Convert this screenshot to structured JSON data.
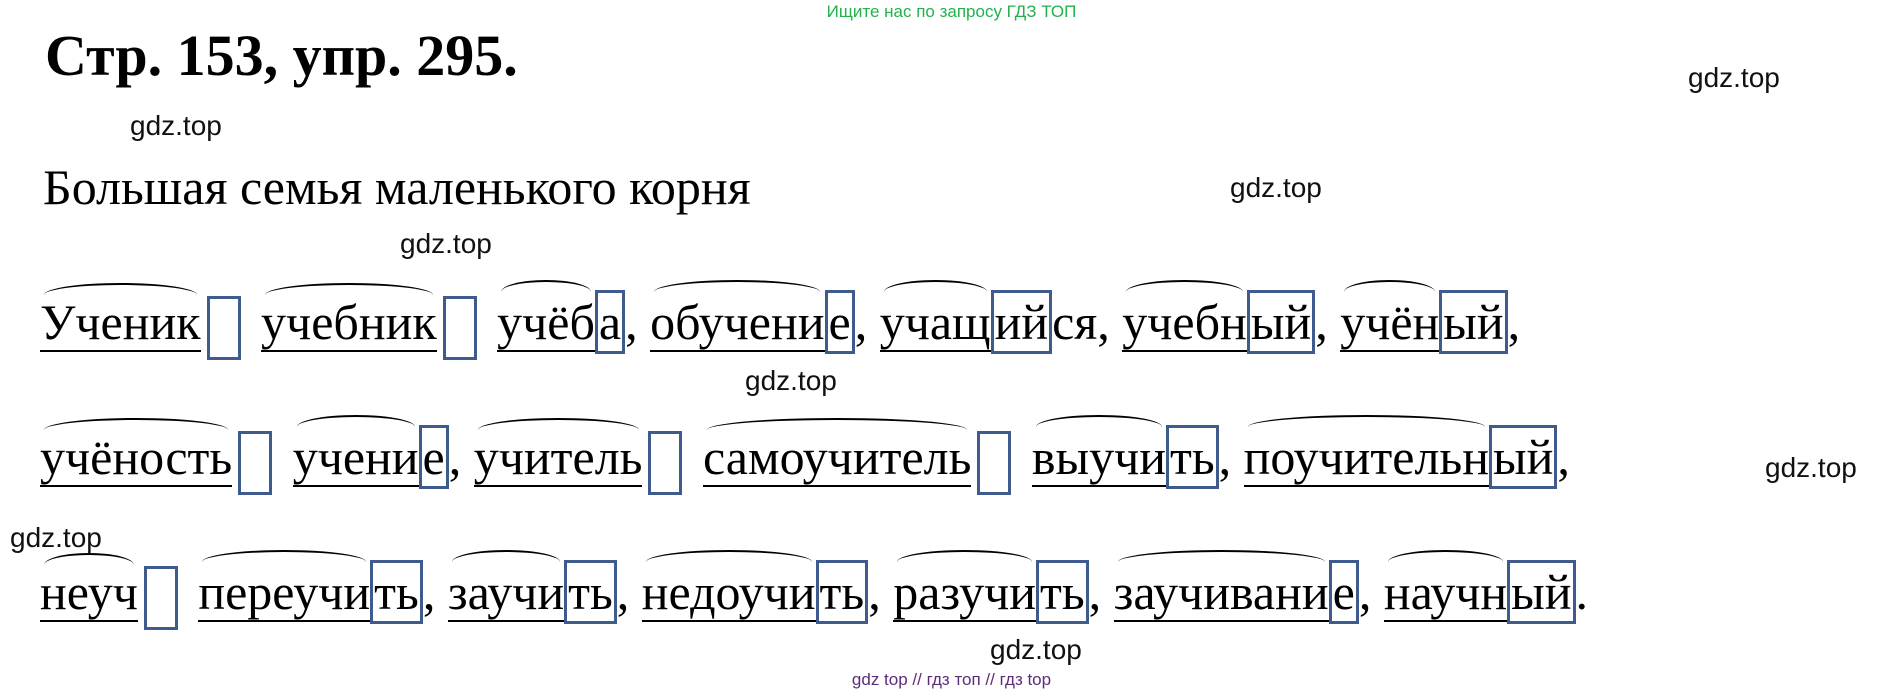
{
  "top_note": "Ищите нас по запросу ГДЗ ТОП",
  "heading": "Стр. 153, упр. 295.",
  "subtitle": "Большая семья маленького корня",
  "watermark": "gdz.top",
  "bottom_note": "gdz top  //  гдз топ  //  гдз top",
  "lines": [
    {
      "words": [
        {
          "text": "Ученик",
          "ending": "",
          "empty_ending": true,
          "punct": ""
        },
        {
          "text": "учебник",
          "ending": "",
          "empty_ending": true,
          "punct": ""
        },
        {
          "text": "учёб",
          "ending": "а",
          "punct": ","
        },
        {
          "text": "обучени",
          "ending": "е",
          "punct": ","
        },
        {
          "text": "уча щ",
          "ending": "ий",
          "suffix": "ся",
          "punct": ","
        },
        {
          "text": "учеб н",
          "ending": "ый",
          "punct": ","
        },
        {
          "text": "учён",
          "ending": "ый",
          "punct": ","
        }
      ]
    },
    {
      "words": [
        {
          "text": "учёность",
          "ending": "",
          "empty_ending": true,
          "punct": ""
        },
        {
          "text": "учени",
          "ending": "е",
          "punct": ","
        },
        {
          "text": "учитель",
          "ending": "",
          "empty_ending": true,
          "punct": ""
        },
        {
          "text": "самоучитель",
          "ending": "",
          "empty_ending": true,
          "punct": ""
        },
        {
          "text": "выучи",
          "ending": "ть",
          "punct": ","
        },
        {
          "text": "поучительн",
          "ending": "ый",
          "punct": ","
        }
      ]
    },
    {
      "words": [
        {
          "text": "неуч",
          "ending": "",
          "empty_ending": true,
          "punct": ""
        },
        {
          "text": "переучи",
          "ending": "ть",
          "punct": ","
        },
        {
          "text": "заучи",
          "ending": "ть",
          "punct": ","
        },
        {
          "text": "недоучи",
          "ending": "ть",
          "punct": ","
        },
        {
          "text": "разучи",
          "ending": "ть",
          "punct": ","
        },
        {
          "text": "заучивани",
          "ending": "е",
          "punct": ","
        },
        {
          "text": "научн",
          "ending": "ый",
          "punct": "."
        }
      ]
    }
  ]
}
